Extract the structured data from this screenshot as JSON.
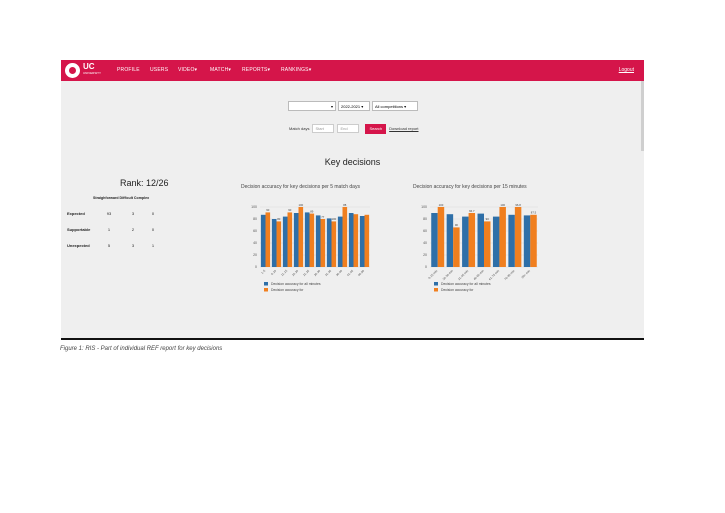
{
  "nav": {
    "brand": "UC",
    "brand_sub": "UNIVERSITY",
    "items": [
      "PROFILE",
      "USERS",
      "VIDEO▾",
      "MATCH▾",
      "REPORTS▾",
      "RANKINGS▾"
    ],
    "logout": "Logout"
  },
  "filters": {
    "season": "2022-2021 ▾",
    "competition": "All competitions ▾",
    "match_days_label": "Match days",
    "start_placeholder": "Start",
    "end_placeholder": "End",
    "search_label": "Search",
    "download_label": "Download report"
  },
  "page_title": "Key decisions",
  "rank": "Rank: 12/26",
  "table": {
    "header": "Straighforward Difficult Complex",
    "rows": [
      {
        "label": "Expected",
        "values": [
          "93",
          "3",
          "0"
        ]
      },
      {
        "label": "Supportable",
        "values": [
          "1",
          "2",
          "0"
        ]
      },
      {
        "label": "Unexpected",
        "values": [
          "5",
          "3",
          "1"
        ]
      }
    ]
  },
  "caption": "Figure 1: RIS - Part of individual REF report for key decisions",
  "chart_data": [
    {
      "type": "bar",
      "title": "Decision accuracy for key decisions per 5 match days",
      "categories": [
        "1-5",
        "6-10",
        "11-15",
        "16-20",
        "21-25",
        "26-30",
        "31-35",
        "36-40",
        "41-45",
        "46-50"
      ],
      "series": [
        {
          "name": "Decision accuracy for all minutes",
          "values": [
            87,
            80,
            84,
            90,
            91,
            86,
            81,
            84,
            90,
            85
          ],
          "color": "#2e6fa8"
        },
        {
          "name": "Decision accuracy for",
          "values": [
            91,
            76,
            91,
            100,
            89,
            80,
            76,
            100,
            88,
            87
          ],
          "color": "#f07f1f"
        }
      ],
      "ylim": [
        0,
        100
      ],
      "yticks": [
        0,
        20,
        40,
        60,
        80,
        100
      ],
      "data_labels": [
        "90",
        "80",
        "90",
        "100",
        "89",
        "77",
        "100",
        "88"
      ],
      "legend": [
        "Decision accuracy for all minutes",
        "Decision accuracy for"
      ]
    },
    {
      "type": "bar",
      "title": "Decision accuracy for key decisions per 15 minutes",
      "categories": [
        "0-15 min",
        "16-30 min",
        "31-45 min",
        "46-60 min",
        "61-75 min",
        "76-90 min",
        "90+ min"
      ],
      "series": [
        {
          "name": "Decision accuracy for all minutes",
          "values": [
            90,
            88,
            84,
            89,
            84,
            87,
            86
          ],
          "color": "#2e6fa8"
        },
        {
          "name": "Decision accuracy for",
          "values": [
            100,
            66,
            90,
            76,
            100,
            100,
            87
          ],
          "color": "#f07f1f"
        }
      ],
      "ylim": [
        0,
        100
      ],
      "yticks": [
        0,
        20,
        40,
        60,
        80,
        100
      ],
      "data_labels": [
        "100",
        "90",
        "66.7",
        "90",
        "100",
        "96.8",
        "87.5"
      ],
      "legend": [
        "Decision accuracy for all minutes",
        "Decision accuracy for"
      ]
    }
  ]
}
